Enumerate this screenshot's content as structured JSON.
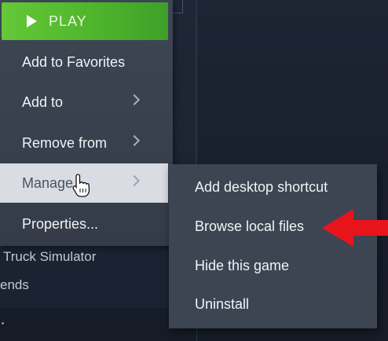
{
  "background": {
    "list_items": [
      "Truck Simulator",
      "ends"
    ]
  },
  "context_menu": {
    "play_label": "PLAY",
    "items": [
      {
        "label": "Add to Favorites",
        "has_submenu": false
      },
      {
        "label": "Add to",
        "has_submenu": true
      },
      {
        "label": "Remove from",
        "has_submenu": true
      },
      {
        "label": "Manage",
        "has_submenu": true,
        "hovered": true
      },
      {
        "label": "Properties...",
        "has_submenu": false
      }
    ]
  },
  "manage_submenu": {
    "items": [
      {
        "label": "Add desktop shortcut"
      },
      {
        "label": "Browse local files"
      },
      {
        "label": "Hide this game"
      },
      {
        "label": "Uninstall"
      }
    ]
  },
  "colors": {
    "play_green": "#5cbf33",
    "menu_bg": "#3d4553",
    "hover_bg": "#d9dde3",
    "annotation_arrow": "#e8141c"
  },
  "icons": [
    "play-icon",
    "chevron-right-icon",
    "hand-pointer-cursor-icon",
    "red-arrow-annotation"
  ]
}
